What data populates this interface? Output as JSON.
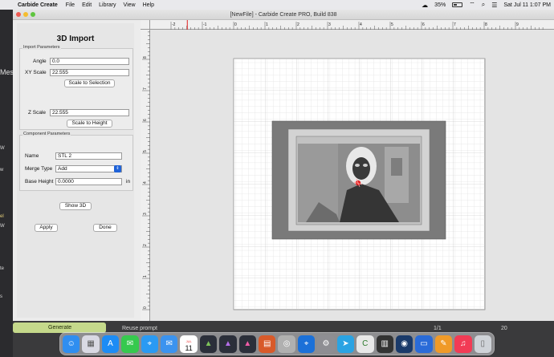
{
  "menubar": {
    "app_name": "Carbide Create",
    "menus": [
      "File",
      "Edit",
      "Library",
      "View",
      "Help"
    ],
    "battery": "35%",
    "clock": "Sat Jul 11  1:07 PM"
  },
  "window": {
    "title": "[NewFile] - Carbide Create PRO, Build 838"
  },
  "panel": {
    "title": "3D Import",
    "import_group_label": "Import Parameters",
    "angle_label": "Angle",
    "angle_value": "0.0",
    "xy_label": "XY Scale",
    "xy_value": "22.555",
    "scale_to_selection": "Scale to Selection",
    "z_label": "Z Scale",
    "z_value": "22.555",
    "scale_to_height": "Scale to Height",
    "component_group_label": "Component Parameters",
    "name_label": "Name",
    "name_value": "STL 2",
    "merge_label": "Merge Type",
    "merge_value": "Add",
    "base_label": "Base Height",
    "base_value": "0.0000",
    "unit": "in",
    "show3d": "Show 3D",
    "apply": "Apply",
    "done": "Done"
  },
  "ruler": {
    "top_ticks": [
      "-2",
      "-1",
      "0",
      "1",
      "2",
      "3",
      "4",
      "5",
      "6",
      "7",
      "8",
      "9"
    ],
    "left_ticks": [
      "8",
      "7",
      "6",
      "5",
      "4",
      "3",
      "2",
      "1",
      "0"
    ]
  },
  "background_app": {
    "side_texts": [
      "Mes",
      "W",
      "w",
      "el",
      "W",
      "te",
      "s"
    ],
    "generate_button": "Generate",
    "reuse_prompt": "Reuse prompt",
    "page_counter": "1/1",
    "page_number": "20"
  },
  "dock": {
    "apps": [
      "Finder",
      "Launchpad",
      "App Store",
      "Messages",
      "Safari",
      "Mail",
      "Calendar",
      "Affinity Designer",
      "Affinity Photo",
      "Affinity Publisher",
      "Carbide",
      "Compressor",
      "Safari Tech",
      "System Preferences",
      "Telegram",
      "Carbide Create",
      "Gallery",
      "Photo Booth",
      "Keynote",
      "Pages",
      "Music",
      "Trash"
    ],
    "calendar_day": "11",
    "calendar_month": "JUL"
  }
}
